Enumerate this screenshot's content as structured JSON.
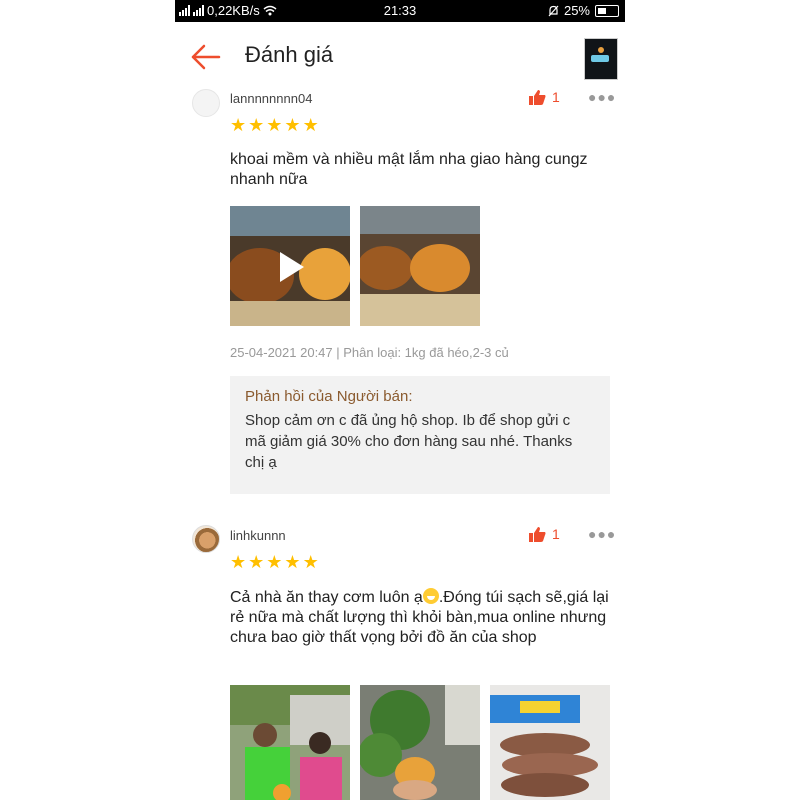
{
  "status_bar": {
    "speed": "0,22KB/s",
    "time": "21:33",
    "battery": "25%"
  },
  "header": {
    "title": "Đánh giá"
  },
  "reviews": [
    {
      "username": "lannnnnnnn04",
      "rating": 5,
      "likes": "1",
      "comment": "khoai mềm và nhiều mật lắm nha giao hàng cungz nhanh nữa",
      "media_count": 2,
      "meta": "25-04-2021 20:47 | Phân loại: 1kg đã héo,2-3 củ",
      "seller_reply": {
        "title": "Phản hồi của Người bán:",
        "text": "Shop cảm ơn c đã ủng hộ shop.  Ib để shop gửi c mã giảm giá 30% cho đơn hàng sau nhé.  Thanks chị ạ"
      }
    },
    {
      "username": "linhkunnn",
      "rating": 5,
      "likes": "1",
      "comment_part1": "Cả nhà ăn thay cơm luôn ạ",
      "comment_part2": ".Đóng túi sạch sẽ,giá lại rẻ nữa mà chất lượng thì khỏi bàn,mua online nhưng chưa bao giờ thất vọng bởi đồ ăn của shop",
      "media_count": 3
    }
  ],
  "colors": {
    "accent": "#ee4d2d",
    "star": "#ffbf00",
    "reply_title": "#8a5a2e",
    "reply_bg": "#f2f2f2"
  }
}
